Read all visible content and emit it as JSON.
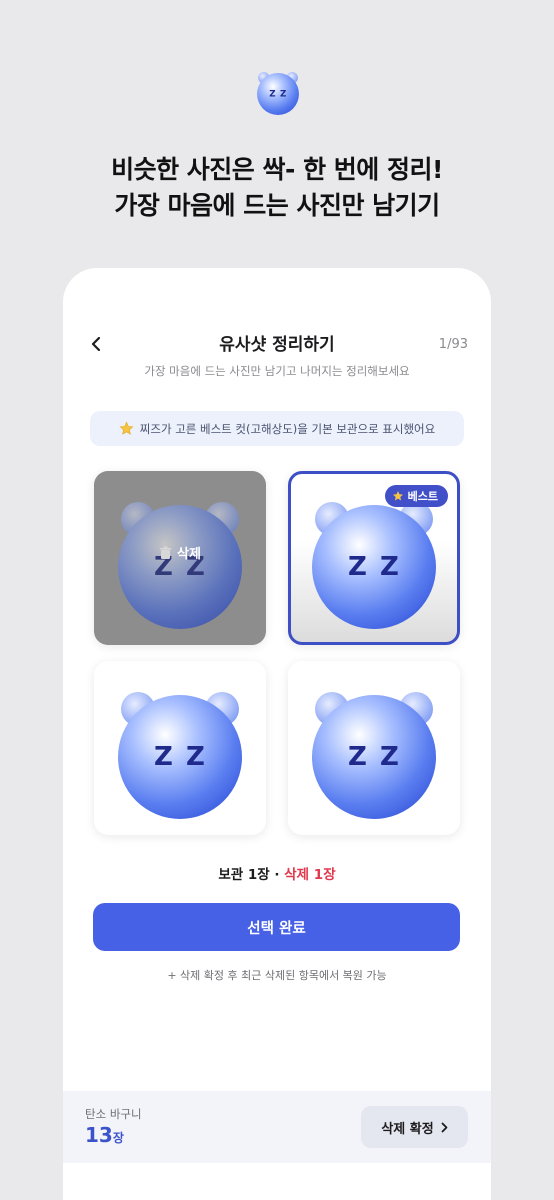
{
  "header": {
    "headline_line1": "비슷한 사진은 싹- 한 번에 정리!",
    "headline_line2": "가장 마음에 드는 사진만 남기기"
  },
  "screen": {
    "title": "유사샷 정리하기",
    "counter": "1/93",
    "subtitle": "가장 마음에 드는 사진만 남기고 나머지는 정리해보세요",
    "notice": "찌즈가 고른 베스트 컷(고해상도)을 기본 보관으로 표시했어요"
  },
  "photos": {
    "delete_label": "삭제",
    "best_label": "베스트"
  },
  "summary": {
    "keep_text": "보관 1장",
    "separator": " · ",
    "delete_text": "삭제 1장"
  },
  "actions": {
    "primary_label": "선택 완료",
    "restore_note": "+ 삭제 확정 후 최근 삭제된 항목에서 복원 가능"
  },
  "basket": {
    "label": "탄소 바구니",
    "count": "13",
    "unit": "장",
    "confirm_label": "삭제 확정"
  },
  "colors": {
    "accent": "#4660e6",
    "selected_border": "#3d4fc4",
    "delete_red": "#e2384e"
  },
  "icons": [
    "back-chevron-icon",
    "star-icon",
    "trash-icon",
    "chevron-right-icon",
    "bear-mascot-icon"
  ]
}
